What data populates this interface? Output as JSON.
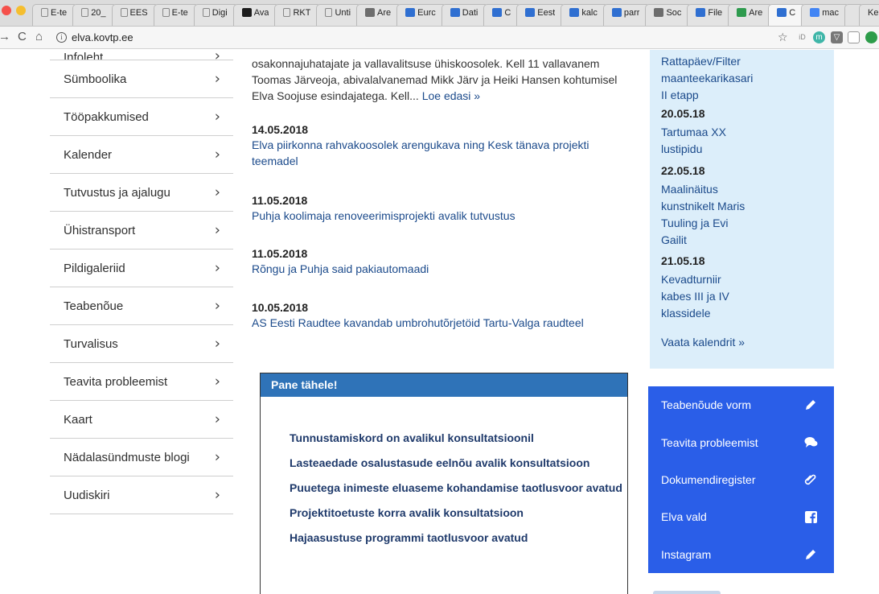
{
  "browser": {
    "tabs": [
      {
        "title": "E-te",
        "icon": "doc"
      },
      {
        "title": "20_",
        "icon": "doc"
      },
      {
        "title": "EES",
        "icon": "doc"
      },
      {
        "title": "E-te",
        "icon": "doc"
      },
      {
        "title": "Digi",
        "icon": "doc"
      },
      {
        "title": "Ava",
        "icon": "brand-dark"
      },
      {
        "title": "RKT",
        "icon": "doc"
      },
      {
        "title": "Unti",
        "icon": "doc"
      },
      {
        "title": "Are",
        "icon": "brand-grey"
      },
      {
        "title": "Eurc",
        "icon": "brand-blue"
      },
      {
        "title": "Dati",
        "icon": "brand-blue"
      },
      {
        "title": "C",
        "icon": "brand-blue"
      },
      {
        "title": "Eest",
        "icon": "brand-blue"
      },
      {
        "title": "kalc",
        "icon": "brand-blue"
      },
      {
        "title": "parr",
        "icon": "brand-blue"
      },
      {
        "title": "Soc",
        "icon": "brand-grey"
      },
      {
        "title": "File",
        "icon": "brand-blue"
      },
      {
        "title": "Are",
        "icon": "brand-green"
      },
      {
        "title": "C",
        "icon": "brand-blue",
        "active": true
      },
      {
        "title": "mac",
        "icon": "brand-google"
      },
      {
        "title": "",
        "icon": "none"
      },
      {
        "title": "Ken",
        "icon": "none"
      }
    ],
    "url": "elva.kovtp.ee"
  },
  "sidebar": {
    "partial_label": "Infoleht",
    "items": [
      "Sümboolika",
      "Tööpakkumised",
      "Kalender",
      "Tutvustus ja ajalugu",
      "Ühistransport",
      "Pildigaleriid",
      "Teabenõue",
      "Turvalisus",
      "Teavita probleemist",
      "Kaart",
      "Nädalasündmuste blogi",
      "Uudiskiri"
    ]
  },
  "news": {
    "intro_lines": [
      "osakonnajuhatajate ja vallavalitsuse ühiskoosolek. Kell 11 vallavanem",
      "Toomas Järveoja, abivalalvanemad Mikk Järv ja Heiki Hansen kohtumisel",
      "Elva Soojuse esindajatega. Kell..."
    ],
    "read_more": "Loe edasi »",
    "items": [
      {
        "date": "14.05.2018",
        "title_lines": [
          "Elva piirkonna rahvakoosolek arengukava ning Kesk tänava projekti",
          "teemadel"
        ]
      },
      {
        "date": "11.05.2018",
        "title_lines": [
          "Puhja koolimaja renoveerimisprojekti avalik tutvustus"
        ]
      },
      {
        "date": "11.05.2018",
        "title_lines": [
          "Rõngu ja Puhja said pakiautomaadi"
        ]
      },
      {
        "date": "10.05.2018",
        "title_lines": [
          "AS Eesti Raudtee kavandab umbrohutõrjetöid Tartu-Valga raudteel"
        ]
      }
    ]
  },
  "notice": {
    "title": "Pane tähele!",
    "links": [
      "Tunnustamiskord on avalikul konsultatsioonil",
      "Lasteaedade osalustasude eelnõu avalik konsultatsioon",
      "Puuetega inimeste eluaseme kohandamise taotlusvoor avatud",
      "Projektitoetuste korra avalik konsultatsioon",
      "Hajaasustuse programmi taotlusvoor avatud"
    ]
  },
  "calendar": {
    "first_event_lines": [
      "Rattapäev/Filter",
      "maanteekarikasari",
      "II etapp"
    ],
    "events": [
      {
        "date": "20.05.18",
        "lines": [
          "Tartumaa XX",
          "lustipidu"
        ]
      },
      {
        "date": "22.05.18",
        "lines": [
          "Maalinäitus",
          "kunstnikelt Maris",
          "Tuuling ja Evi",
          "Gailit"
        ]
      },
      {
        "date": "21.05.18",
        "lines": [
          "Kevadturniir",
          "kabes III ja IV",
          "klassidele"
        ]
      }
    ],
    "see_all": "Vaata kalendrit »"
  },
  "quick_links": [
    {
      "label": "Teabenõude vorm",
      "icon": "pencil-icon"
    },
    {
      "label": "Teavita probleemist",
      "icon": "chat-bubbles-icon"
    },
    {
      "label": "Dokumendiregister",
      "icon": "paperclip-icon"
    },
    {
      "label": "Elva vald",
      "icon": "facebook-icon"
    },
    {
      "label": "Instagram",
      "icon": "pencil-icon"
    }
  ],
  "colors": {
    "link": "#1b4a8b",
    "notice_header": "#2f73b8",
    "calendar_bg": "#dceefa",
    "quick_bg": "#2a5ee8"
  }
}
